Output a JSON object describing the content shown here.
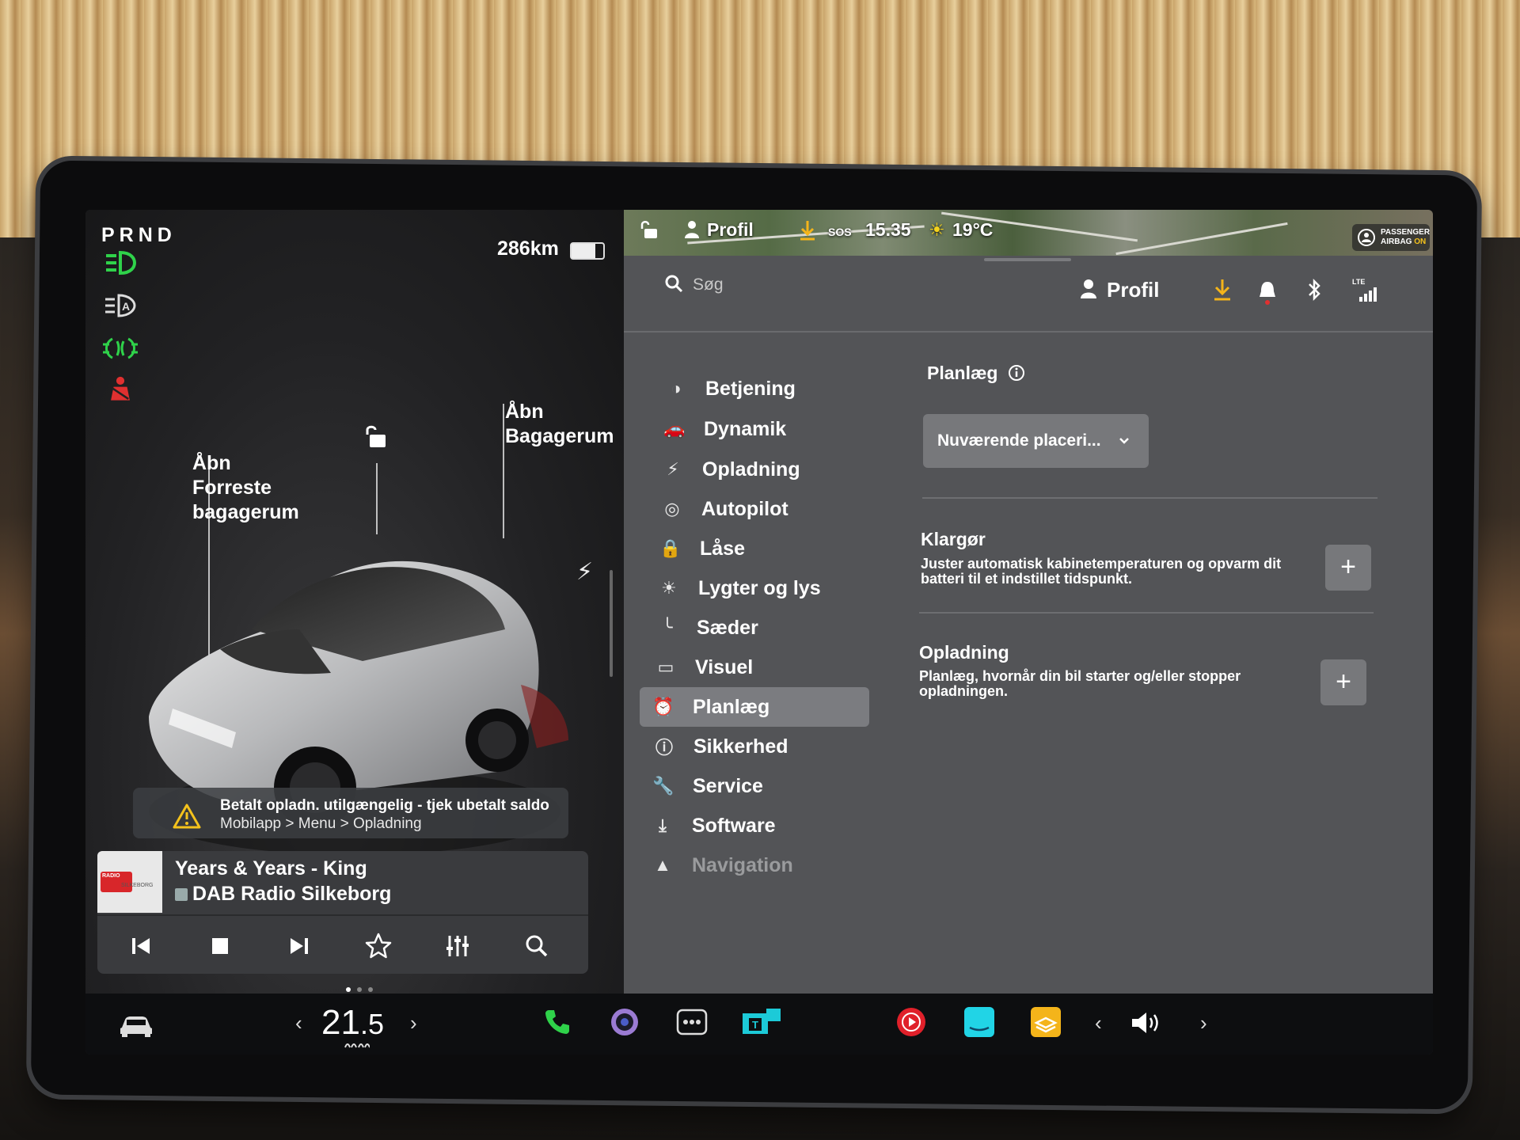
{
  "gear": "PRND",
  "range": "286km",
  "battery_level": 0.75,
  "indicators": [
    "headlight-on-icon",
    "auto-highbeam-icon",
    "fog-light-icon",
    "seatbelt-warning-icon"
  ],
  "car": {
    "frunk_label": "Åbn Forreste bagagerum",
    "trunk_label": "Åbn Bagagerum",
    "lock_state": "unlocked"
  },
  "alert": {
    "title": "Betalt opladn. utilgængelig - tjek ubetalt saldo",
    "path": "Mobilapp > Menu > Opladning"
  },
  "media": {
    "song": "Years & Years - King",
    "station": "DAB Radio Silkeborg",
    "thumb_label": "RADIO",
    "thumb_text": "SILKEBORG"
  },
  "statusbar": {
    "profile": "Profil",
    "sos": "SOS",
    "time": "15.35",
    "temperature": "19°C",
    "airbag_line1": "PASSENGER",
    "airbag_line2": "AIRBAG",
    "airbag_state": "ON"
  },
  "search": {
    "placeholder": "Søg"
  },
  "header": {
    "profile_label": "Profil",
    "network": "LTE"
  },
  "menu": [
    {
      "label": "Betjening",
      "icon": "toggle-icon"
    },
    {
      "label": "Dynamik",
      "icon": "car-icon"
    },
    {
      "label": "Opladning",
      "icon": "bolt-icon"
    },
    {
      "label": "Autopilot",
      "icon": "steering-wheel-icon"
    },
    {
      "label": "Låse",
      "icon": "lock-icon"
    },
    {
      "label": "Lygter og lys",
      "icon": "light-icon"
    },
    {
      "label": "Sæder",
      "icon": "seat-icon"
    },
    {
      "label": "Visuel",
      "icon": "display-icon"
    },
    {
      "label": "Planlæg",
      "icon": "alarm-clock-icon"
    },
    {
      "label": "Sikkerhed",
      "icon": "info-icon"
    },
    {
      "label": "Service",
      "icon": "wrench-icon"
    },
    {
      "label": "Software",
      "icon": "download-icon"
    },
    {
      "label": "Navigation",
      "icon": "navigation-icon"
    }
  ],
  "schedule": {
    "title": "Planlæg",
    "location_dropdown": "Nuværende placeri...",
    "precondition_title": "Klargør",
    "precondition_desc": "Juster automatisk kabinetemperaturen og opvarm dit batteri til et indstillet tidspunkt.",
    "charging_title": "Opladning",
    "charging_desc": "Planlæg, hvornår din bil starter og/eller stopper opladningen."
  },
  "climate": {
    "temp_whole": "21",
    "temp_decimal": ".5"
  },
  "colors": {
    "accent_green": "#2fd24a",
    "warning_red": "#e03030",
    "download_yellow": "#f4b41a",
    "panel_bg": "#535457"
  }
}
